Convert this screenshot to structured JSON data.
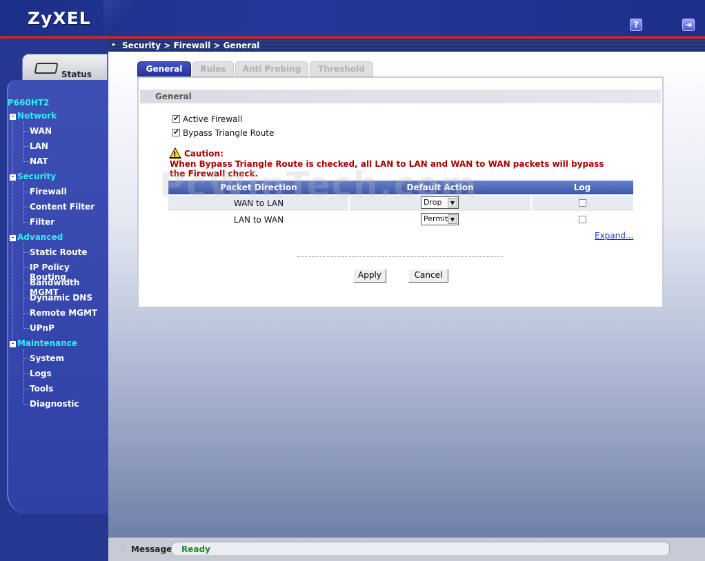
{
  "header": {
    "logo": "ZyXEL",
    "help_icon": "?",
    "logout_icon": "exit"
  },
  "breadcrumb": "Security > Firewall > General",
  "sidebar": {
    "status_label": "Status",
    "model": "P660HT2",
    "sections": [
      {
        "label": "Network",
        "items": [
          "WAN",
          "LAN",
          "NAT"
        ]
      },
      {
        "label": "Security",
        "items": [
          "Firewall",
          "Content Filter",
          "Filter"
        ]
      },
      {
        "label": "Advanced",
        "items": [
          "Static Route",
          "IP Policy Routing",
          "Bandwidth MGMT",
          "Dynamic DNS",
          "Remote MGMT",
          "UPnP"
        ]
      },
      {
        "label": "Maintenance",
        "items": [
          "System",
          "Logs",
          "Tools",
          "Diagnostic"
        ]
      }
    ]
  },
  "tabs": [
    "General",
    "Rules",
    "Anti Probing",
    "Threshold"
  ],
  "panel": {
    "title": "General",
    "active_firewall": {
      "label": "Active Firewall",
      "checked": true
    },
    "bypass_triangle": {
      "label": "Bypass Triangle Route",
      "checked": true
    },
    "caution_title": "Caution:",
    "caution_text": "When Bypass Triangle Route is checked, all LAN to LAN and WAN to WAN packets will bypass the Firewall check.",
    "watermark": "PcWinTech.com",
    "table": {
      "headers": [
        "Packet Direction",
        "Default Action",
        "Log"
      ],
      "rows": [
        {
          "direction": "WAN to LAN",
          "action": "Drop",
          "log": false
        },
        {
          "direction": "LAN to WAN",
          "action": "Permit",
          "log": false
        }
      ]
    },
    "expand_link": "Expand...",
    "apply_label": "Apply",
    "cancel_label": "Cancel"
  },
  "message": {
    "label": "Message",
    "text": "Ready"
  },
  "colors": {
    "accent": "#26378f",
    "header_red": "#c2272d",
    "caution": "#aa0000",
    "ready": "#1b8a2a"
  }
}
